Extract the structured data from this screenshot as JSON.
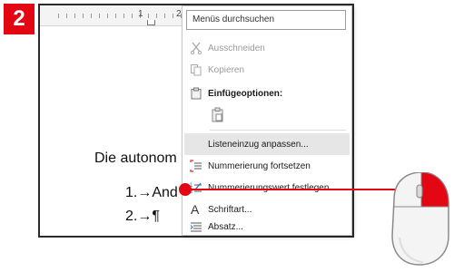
{
  "step_badge": "2",
  "ruler": {
    "label_1": "1",
    "label_2": "2"
  },
  "document": {
    "line_heading": "Die autonom",
    "list_item_1": "1.→And",
    "list_item_2": "2.→¶"
  },
  "context_menu": {
    "search_placeholder": "Menüs durchsuchen",
    "items": [
      {
        "label": "Ausschneiden",
        "icon": "scissors-icon",
        "state": "disabled"
      },
      {
        "label": "Kopieren",
        "icon": "copy-icon",
        "state": "disabled"
      },
      {
        "label": "Einfügeoptionen:",
        "icon": "clipboard-icon",
        "state": "header"
      },
      {
        "label": "Listeneinzug anpassen...",
        "icon": "",
        "state": "highlighted"
      },
      {
        "label": "Nummerierung fortsetzen",
        "icon": "continue-numbering-icon",
        "state": "normal"
      },
      {
        "label": "Nummerierungswert festlegen...",
        "icon": "set-numbering-value-icon",
        "state": "normal"
      },
      {
        "label": "Schriftart...",
        "icon": "font-icon",
        "state": "normal"
      },
      {
        "label": "Absatz...",
        "icon": "paragraph-icon",
        "state": "normal"
      }
    ]
  },
  "colors": {
    "accent": "#e30613",
    "menu_highlight": "#e6e6e6",
    "icon_blue": "#2b6cc4",
    "icon_red": "#d03030"
  }
}
